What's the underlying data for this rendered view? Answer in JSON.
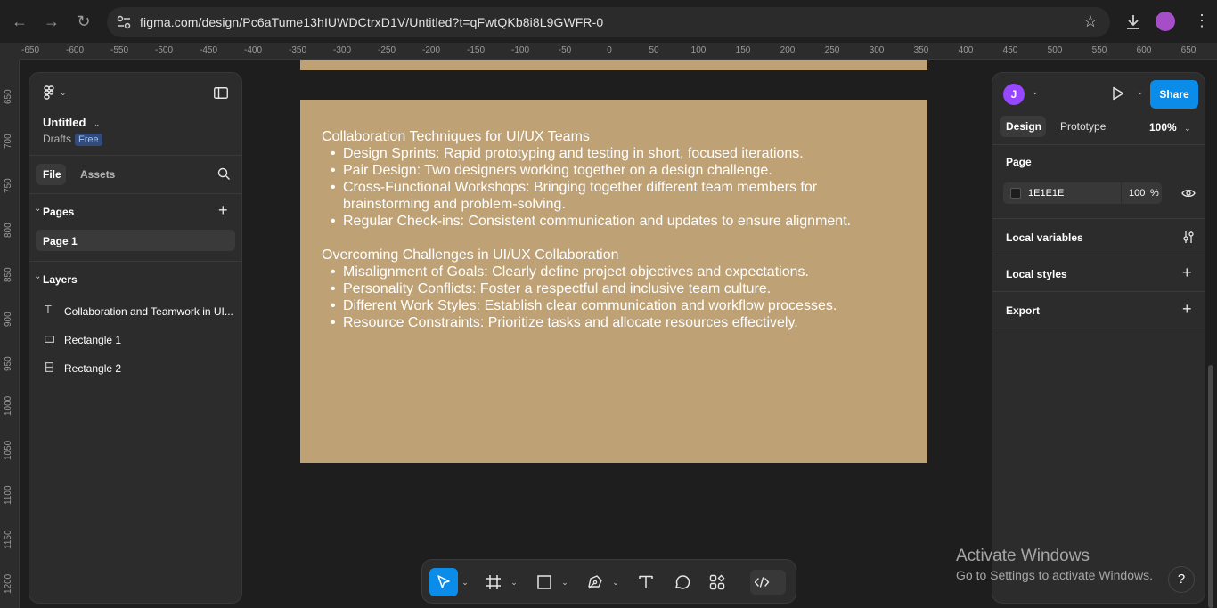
{
  "browser": {
    "url": "figma.com/design/Pc6aTume13hIUWDCtrxD1V/Untitled?t=qFwtQKb8i8L9GWFR-0"
  },
  "rulers": {
    "top": [
      "-650",
      "-600",
      "-550",
      "-500",
      "-450",
      "-400",
      "-350",
      "-300",
      "-250",
      "-200",
      "-150",
      "-100",
      "-50",
      "0",
      "50",
      "100",
      "150",
      "200",
      "250",
      "300",
      "350",
      "400",
      "450",
      "500",
      "550",
      "600",
      "650"
    ],
    "left": [
      "650",
      "700",
      "750",
      "800",
      "850",
      "900",
      "950",
      "1000",
      "1050",
      "1100",
      "1150",
      "1200"
    ]
  },
  "file": {
    "title": "Untitled",
    "location": "Drafts",
    "plan_badge": "Free"
  },
  "left_tabs": {
    "file": "File",
    "assets": "Assets"
  },
  "pages": {
    "heading": "Pages",
    "items": [
      "Page 1"
    ]
  },
  "layers": {
    "heading": "Layers",
    "items": [
      {
        "name": "Collaboration and Teamwork in UI...",
        "icon": "text-layer-icon"
      },
      {
        "name": "Rectangle 1",
        "icon": "rectangle-layer-icon"
      },
      {
        "name": "Rectangle 2",
        "icon": "rectangle-layer-icon"
      }
    ]
  },
  "canvas_text": {
    "section1": {
      "heading": "Collaboration Techniques for UI/UX Teams",
      "bullets": [
        "Design Sprints: Rapid prototyping and testing in short, focused iterations.",
        "Pair Design: Two designers working together on a design challenge.",
        "Cross-Functional Workshops: Bringing together different team members for brainstorming and problem-solving.",
        "Regular Check-ins: Consistent communication and updates to ensure alignment."
      ]
    },
    "section2": {
      "heading": "Overcoming Challenges in UI/UX Collaboration",
      "bullets": [
        "Misalignment of Goals: Clearly define project objectives and expectations.",
        "Personality Conflicts: Foster a respectful and inclusive team culture.",
        "Different Work Styles: Establish clear communication and workflow processes.",
        "Resource Constraints: Prioritize tasks and allocate resources effectively."
      ]
    }
  },
  "right_panel": {
    "avatar_initial": "J",
    "share_label": "Share",
    "tabs": {
      "design": "Design",
      "prototype": "Prototype"
    },
    "zoom": "100%",
    "page_section": "Page",
    "page_color": "1E1E1E",
    "page_opacity": "100",
    "percent": "%",
    "local_variables": "Local variables",
    "local_styles": "Local styles",
    "export": "Export"
  },
  "windows_notice": {
    "title": "Activate Windows",
    "subtitle": "Go to Settings to activate Windows."
  },
  "help_label": "?",
  "colors": {
    "frame_fill": "#bea175",
    "accent": "#0c8ce9",
    "canvas_bg": "#1e1e1e",
    "panel_bg": "#2c2c2c"
  }
}
